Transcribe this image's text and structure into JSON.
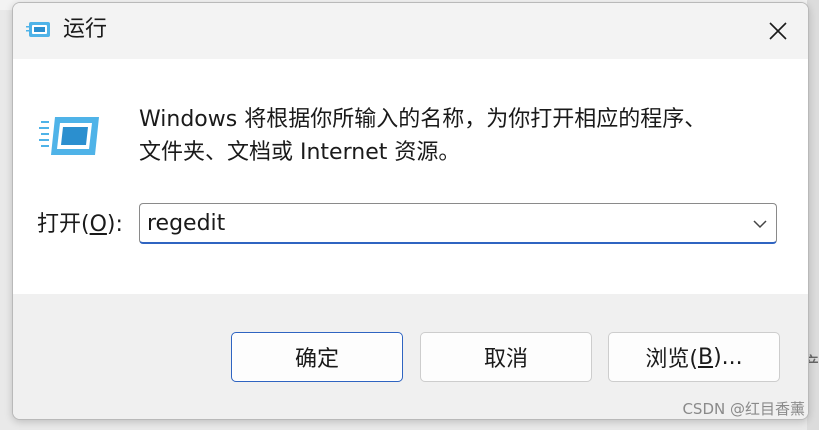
{
  "window": {
    "title": "运行"
  },
  "dialog": {
    "description_line1": "Windows 将根据你所输入的名称，为你打开相应的程序、",
    "description_line2": "文件夹、文档或 Internet 资源。",
    "open_label_prefix": "打开(",
    "open_label_key": "O",
    "open_label_suffix": "):",
    "input_value": "regedit"
  },
  "buttons": {
    "ok": "确定",
    "cancel": "取消",
    "browse_prefix": "浏览(",
    "browse_key": "B",
    "browse_suffix": ")..."
  },
  "background": {
    "right_edge_text": "浐"
  },
  "watermark": "CSDN @红目香薰",
  "icons": {
    "title": "run-app-icon",
    "close": "close-icon",
    "dropdown": "chevron-down-icon",
    "main": "run-app-icon"
  },
  "colors": {
    "accent": "#2f64c1",
    "icon_blue": "#4fb3e8"
  }
}
